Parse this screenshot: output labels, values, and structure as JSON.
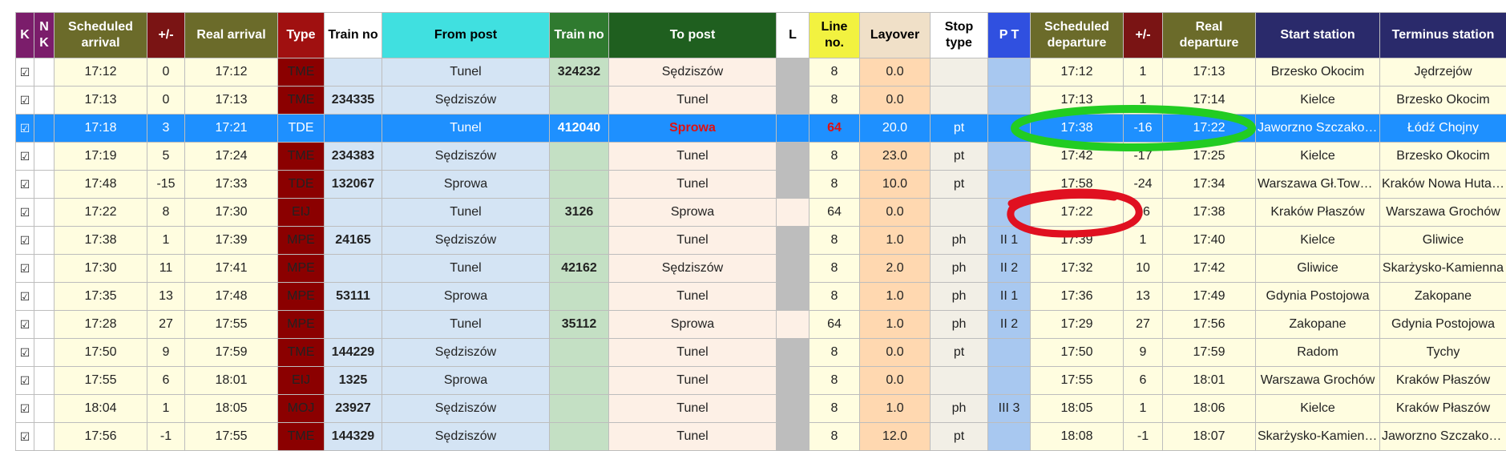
{
  "colors": {
    "sel_row": "#1e90ff",
    "green_mark": "#22cc22",
    "red_mark": "#e01020",
    "type_cell": "#8b0000"
  },
  "columns": [
    {
      "key": "k",
      "label": "K",
      "bg": "#7b1d6b"
    },
    {
      "key": "nk",
      "label": "N K",
      "bg": "#7b1d6b"
    },
    {
      "key": "sch_arr",
      "label": "Scheduled arrival",
      "bg": "#6b6b2a"
    },
    {
      "key": "pm_arr",
      "label": "+/-",
      "bg": "#7a1414"
    },
    {
      "key": "real_arr",
      "label": "Real arrival",
      "bg": "#6b6b2a"
    },
    {
      "key": "type",
      "label": "Type",
      "bg": "#a01010"
    },
    {
      "key": "train_in",
      "label": "Train no",
      "bg": "#ffffff",
      "fg": "#000000"
    },
    {
      "key": "from",
      "label": "From post",
      "bg": "#40e0e0",
      "fg": "#000000"
    },
    {
      "key": "train_out",
      "label": "Train no",
      "bg": "#2f7a2f"
    },
    {
      "key": "to",
      "label": "To post",
      "bg": "#1f5f1f"
    },
    {
      "key": "l",
      "label": "L",
      "bg": "#ffffff",
      "fg": "#000000"
    },
    {
      "key": "line",
      "label": "Line no.",
      "bg": "#f2f240",
      "fg": "#000000"
    },
    {
      "key": "layover",
      "label": "Layover",
      "bg": "#f0e0c8",
      "fg": "#000000"
    },
    {
      "key": "stop",
      "label": "Stop type",
      "bg": "#ffffff",
      "fg": "#000000"
    },
    {
      "key": "pt",
      "label": "P T",
      "bg": "#3050e0"
    },
    {
      "key": "sch_dep",
      "label": "Scheduled departure",
      "bg": "#6b6b2a"
    },
    {
      "key": "pm_dep",
      "label": "+/-",
      "bg": "#7a1414"
    },
    {
      "key": "real_dep",
      "label": "Real departure",
      "bg": "#6b6b2a"
    },
    {
      "key": "start",
      "label": "Start station",
      "bg": "#2a2a6b"
    },
    {
      "key": "term",
      "label": "Terminus station",
      "bg": "#2a2a6b"
    }
  ],
  "rows": [
    {
      "k": "☑",
      "sch_arr": "17:12",
      "pm_arr": "0",
      "real_arr": "17:12",
      "type": "TME",
      "train_in": "",
      "from": "Tunel",
      "train_out": "324232",
      "to": "Sędziszów",
      "line": "8",
      "layover": "0.0",
      "stop": "",
      "pt": "",
      "sch_dep": "17:12",
      "pm_dep": "1",
      "real_dep": "17:13",
      "start": "Brzesko Okocim",
      "term": "Jędrzejów"
    },
    {
      "k": "☑",
      "sch_arr": "17:13",
      "pm_arr": "0",
      "real_arr": "17:13",
      "type": "TME",
      "train_in": "234335",
      "from": "Sędziszów",
      "train_out": "",
      "to": "Tunel",
      "line": "8",
      "layover": "0.0",
      "stop": "",
      "pt": "",
      "sch_dep": "17:13",
      "pm_dep": "1",
      "real_dep": "17:14",
      "start": "Kielce",
      "term": "Brzesko Okocim"
    },
    {
      "k": "☑",
      "sch_arr": "17:18",
      "pm_arr": "3",
      "real_arr": "17:21",
      "type": "TDE",
      "train_in": "",
      "from": "Tunel",
      "train_out": "412040",
      "to": "Sprowa",
      "line": "64",
      "layover": "20.0",
      "stop": "pt",
      "pt": "",
      "sch_dep": "17:38",
      "pm_dep": "-16",
      "real_dep": "17:22",
      "start": "Jaworzno Szczakowa",
      "term": "Łódź Chojny",
      "selected": true
    },
    {
      "k": "☑",
      "sch_arr": "17:19",
      "pm_arr": "5",
      "real_arr": "17:24",
      "type": "TME",
      "train_in": "234383",
      "from": "Sędziszów",
      "train_out": "",
      "to": "Tunel",
      "line": "8",
      "layover": "23.0",
      "stop": "pt",
      "pt": "",
      "sch_dep": "17:42",
      "pm_dep": "-17",
      "real_dep": "17:25",
      "start": "Kielce",
      "term": "Brzesko Okocim"
    },
    {
      "k": "☑",
      "sch_arr": "17:48",
      "pm_arr": "-15",
      "real_arr": "17:33",
      "type": "TDE",
      "train_in": "132067",
      "from": "Sprowa",
      "train_out": "",
      "to": "Tunel",
      "line": "8",
      "layover": "10.0",
      "stop": "pt",
      "pt": "",
      "sch_dep": "17:58",
      "pm_dep": "-24",
      "real_dep": "17:34",
      "start": "Warszawa Gł.Towarowa",
      "term": "Kraków Nowa Huta Towarowa"
    },
    {
      "k": "☑",
      "sch_arr": "17:22",
      "pm_arr": "8",
      "real_arr": "17:30",
      "type": "EIJ",
      "train_in": "",
      "from": "Tunel",
      "train_out": "3126",
      "to": "Sprowa",
      "line": "64",
      "layover": "0.0",
      "stop": "",
      "pt": "",
      "sch_dep": "17:22",
      "pm_dep": "16",
      "real_dep": "17:38",
      "start": "Kraków Płaszów",
      "term": "Warszawa Grochów"
    },
    {
      "k": "☑",
      "sch_arr": "17:38",
      "pm_arr": "1",
      "real_arr": "17:39",
      "type": "MPE",
      "train_in": "24165",
      "from": "Sędziszów",
      "train_out": "",
      "to": "Tunel",
      "line": "8",
      "layover": "1.0",
      "stop": "ph",
      "pt": "II 1",
      "sch_dep": "17:39",
      "pm_dep": "1",
      "real_dep": "17:40",
      "start": "Kielce",
      "term": "Gliwice"
    },
    {
      "k": "☑",
      "sch_arr": "17:30",
      "pm_arr": "11",
      "real_arr": "17:41",
      "type": "MPE",
      "train_in": "",
      "from": "Tunel",
      "train_out": "42162",
      "to": "Sędziszów",
      "line": "8",
      "layover": "2.0",
      "stop": "ph",
      "pt": "II 2",
      "sch_dep": "17:32",
      "pm_dep": "10",
      "real_dep": "17:42",
      "start": "Gliwice",
      "term": "Skarżysko-Kamienna"
    },
    {
      "k": "☑",
      "sch_arr": "17:35",
      "pm_arr": "13",
      "real_arr": "17:48",
      "type": "MPE",
      "train_in": "53111",
      "from": "Sprowa",
      "train_out": "",
      "to": "Tunel",
      "line": "8",
      "layover": "1.0",
      "stop": "ph",
      "pt": "II 1",
      "sch_dep": "17:36",
      "pm_dep": "13",
      "real_dep": "17:49",
      "start": "Gdynia Postojowa",
      "term": "Zakopane"
    },
    {
      "k": "☑",
      "sch_arr": "17:28",
      "pm_arr": "27",
      "real_arr": "17:55",
      "type": "MPE",
      "train_in": "",
      "from": "Tunel",
      "train_out": "35112",
      "to": "Sprowa",
      "line": "64",
      "layover": "1.0",
      "stop": "ph",
      "pt": "II 2",
      "sch_dep": "17:29",
      "pm_dep": "27",
      "real_dep": "17:56",
      "start": "Zakopane",
      "term": "Gdynia Postojowa"
    },
    {
      "k": "☑",
      "sch_arr": "17:50",
      "pm_arr": "9",
      "real_arr": "17:59",
      "type": "TME",
      "train_in": "144229",
      "from": "Sędziszów",
      "train_out": "",
      "to": "Tunel",
      "line": "8",
      "layover": "0.0",
      "stop": "pt",
      "pt": "",
      "sch_dep": "17:50",
      "pm_dep": "9",
      "real_dep": "17:59",
      "start": "Radom",
      "term": "Tychy"
    },
    {
      "k": "☑",
      "sch_arr": "17:55",
      "pm_arr": "6",
      "real_arr": "18:01",
      "type": "EIJ",
      "train_in": "1325",
      "from": "Sprowa",
      "train_out": "",
      "to": "Tunel",
      "line": "8",
      "layover": "0.0",
      "stop": "",
      "pt": "",
      "sch_dep": "17:55",
      "pm_dep": "6",
      "real_dep": "18:01",
      "start": "Warszawa Grochów",
      "term": "Kraków Płaszów"
    },
    {
      "k": "☑",
      "sch_arr": "18:04",
      "pm_arr": "1",
      "real_arr": "18:05",
      "type": "MOJ",
      "train_in": "23927",
      "from": "Sędziszów",
      "train_out": "",
      "to": "Tunel",
      "line": "8",
      "layover": "1.0",
      "stop": "ph",
      "pt": "III 3",
      "sch_dep": "18:05",
      "pm_dep": "1",
      "real_dep": "18:06",
      "start": "Kielce",
      "term": "Kraków Płaszów"
    },
    {
      "k": "☑",
      "sch_arr": "17:56",
      "pm_arr": "-1",
      "real_arr": "17:55",
      "type": "TME",
      "train_in": "144329",
      "from": "Sędziszów",
      "train_out": "",
      "to": "Tunel",
      "line": "8",
      "layover": "12.0",
      "stop": "pt",
      "pt": "",
      "sch_dep": "18:08",
      "pm_dep": "-1",
      "real_dep": "18:07",
      "start": "Skarżysko-Kamienna",
      "term": "Jaworzno Szczakowa"
    }
  ]
}
